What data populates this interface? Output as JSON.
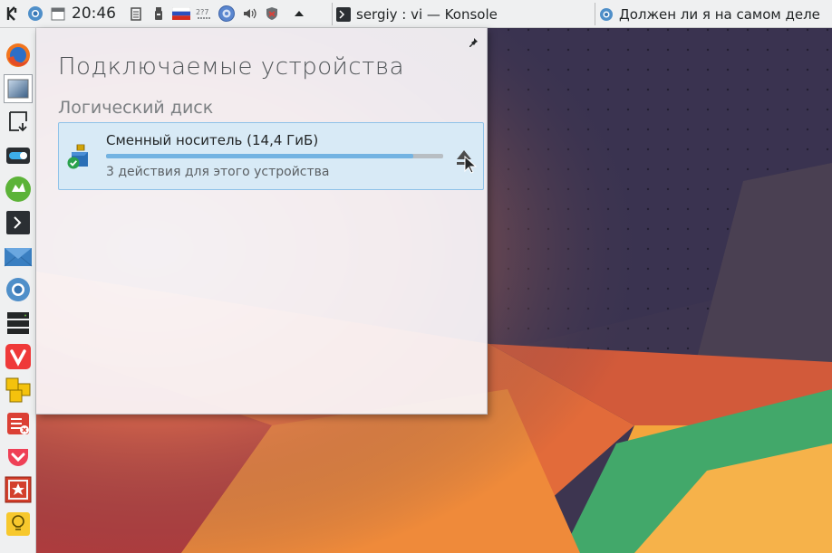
{
  "top_panel": {
    "clock": "20:46",
    "tasks": [
      {
        "title": "sergiy : vi — Konsole"
      },
      {
        "title": "Должен ли я на самом деле"
      }
    ],
    "tray_icons": [
      "kde-logo-icon",
      "chromium-icon",
      "clipboard-icon",
      "usb-drive-icon",
      "russian-flag-icon",
      "network-icon",
      "settings-gear-icon",
      "volume-icon",
      "shield-icon",
      "expand-arrow-icon"
    ]
  },
  "dock": {
    "items": [
      "firefox-icon",
      "image-viewer-icon",
      "download-icon",
      "toggle-icon",
      "file-manager-icon",
      "terminal-icon",
      "mail-icon",
      "chromium-icon",
      "server-icon",
      "vivaldi-icon",
      "puzzle-icon",
      "todoist-icon",
      "pocket-icon",
      "bookmark-star-icon",
      "lightbulb-icon"
    ]
  },
  "popup": {
    "title": "Подключаемые устройства",
    "section": "Логический диск",
    "device": {
      "name": "Сменный носитель (14,4 ГиБ)",
      "actions": "3 действия для этого устройства",
      "usage_fraction": 0.91
    }
  },
  "colors": {
    "panel_bg": "#eff0f1",
    "device_highlight": "#d8eaf6",
    "usage_fill": "#73b3e2"
  }
}
